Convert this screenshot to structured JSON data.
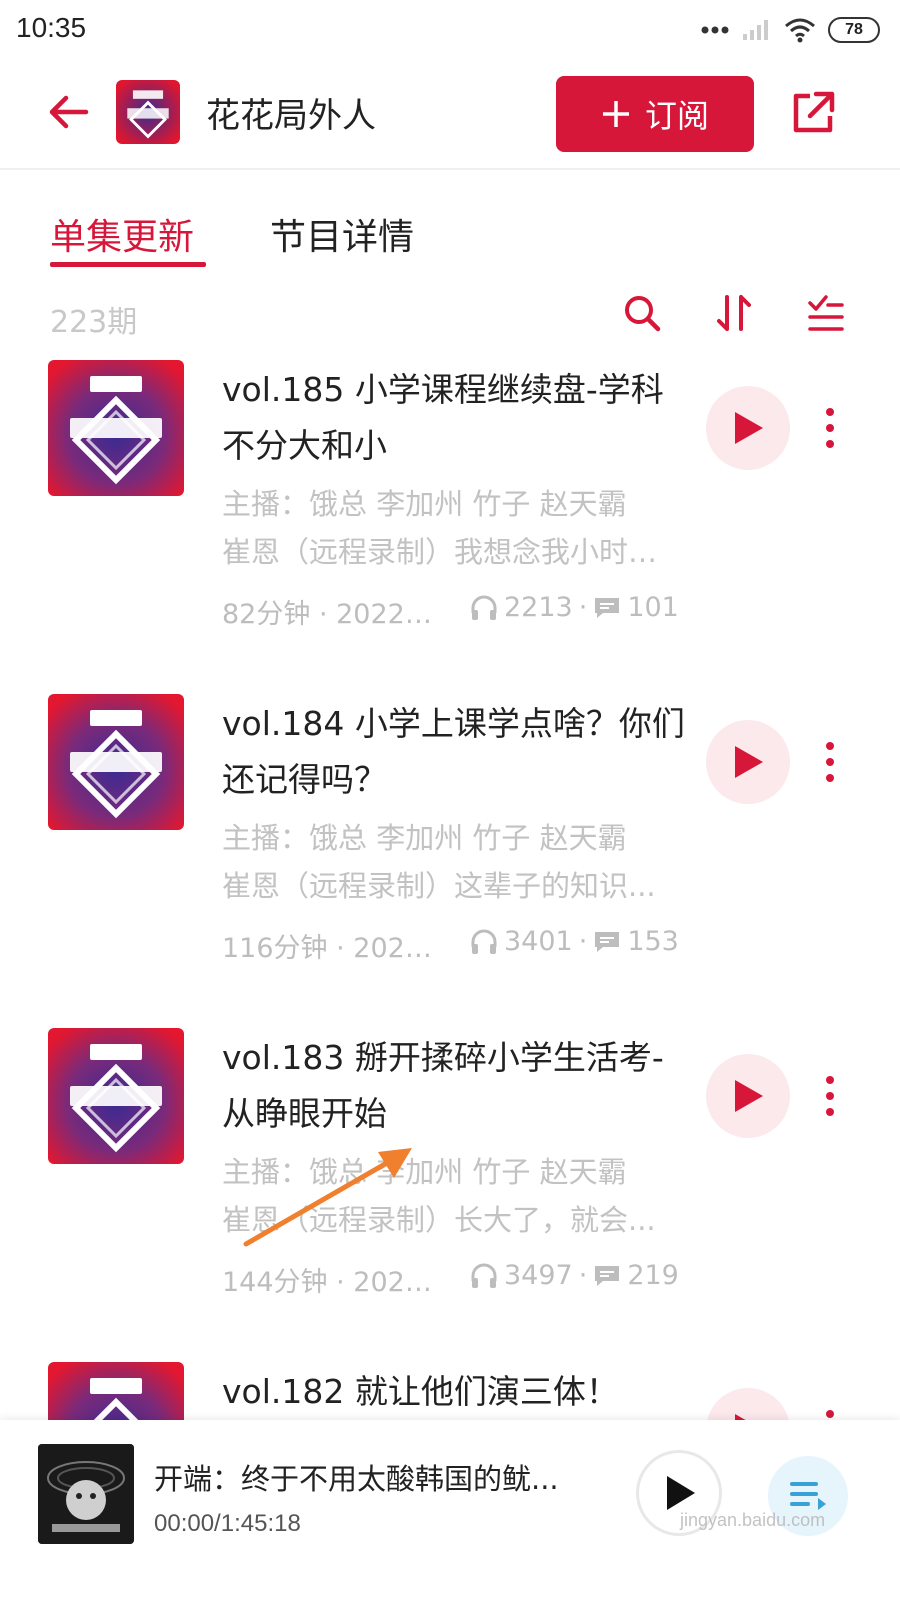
{
  "status_bar": {
    "time": "10:35",
    "battery": "78"
  },
  "header": {
    "podcast_title": "花花局外人",
    "subscribe_label": "订阅"
  },
  "tabs": [
    {
      "label": "单集更新",
      "active": true
    },
    {
      "label": "节目详情",
      "active": false
    }
  ],
  "toolbar": {
    "episode_count": "223期"
  },
  "episodes": [
    {
      "title": "vol.185 小学课程继续盘-学科不分大和小",
      "desc_line1": "主播：饿总 李加州 竹子 赵天霸",
      "desc_line2": "崔恩（远程录制）我想念我小时候...",
      "duration": "82分钟 · 2022/...",
      "plays": "2213",
      "comments": "101"
    },
    {
      "title": "vol.184 小学上课学点啥？你们还记得吗？",
      "desc_line1": "主播：饿总 李加州 竹子 赵天霸",
      "desc_line2": "崔恩（远程录制）这辈子的知识...",
      "duration": "116分钟 · 2022...",
      "plays": "3401",
      "comments": "153"
    },
    {
      "title": "vol.183 掰开揉碎小学生活考-从睁眼开始",
      "desc_line1": "主播：饿总 李加州 竹子 赵天霸",
      "desc_line2": "崔恩（远程录制）长大了，就会...",
      "duration": "144分钟 · 2022...",
      "plays": "3497",
      "comments": "219"
    },
    {
      "title": "vol.182 就让他们演三体！",
      "desc_line1": "",
      "desc_line2": "",
      "duration": "",
      "plays": "",
      "comments": ""
    }
  ],
  "mini_player": {
    "title": "开端：终于不用太酸韩国的鱿...",
    "time": "00:00/1:45:18"
  },
  "watermark": "jingyan.baidu.com",
  "colors": {
    "accent": "#d6173a",
    "muted": "#c2c2c2",
    "play_bg": "#fbe9ec",
    "annotation_arrow": "#f07f2e"
  },
  "icons": {
    "back": "arrow-left-icon",
    "share": "share-icon",
    "search": "search-icon",
    "sort": "sort-icon",
    "filter": "list-check-icon",
    "play": "play-icon",
    "more": "more-vertical-icon",
    "headphones": "headphones-icon",
    "comment": "comment-icon",
    "playlist": "playlist-icon"
  }
}
